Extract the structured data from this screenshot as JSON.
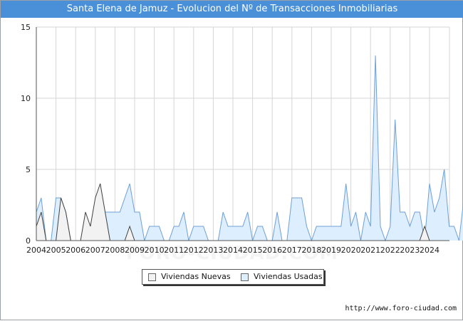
{
  "title": "Santa Elena de Jamuz - Evolucion del Nº de Transacciones Inmobiliarias",
  "source": "http://www.foro-ciudad.com",
  "watermark": "FORO-CIUDAD.COM",
  "colors": {
    "title_bar": "#4a90d9",
    "nuevas_fill": "#f2f2f2",
    "nuevas_line": "#404040",
    "usadas_fill": "#ddeeff",
    "usadas_line": "#6e9fd6",
    "grid": "#d6d6d6"
  },
  "chart_data": {
    "type": "area",
    "x_unit": "quarter",
    "x_start": "2004 Q1",
    "ylim": [
      0,
      15
    ],
    "yticks": [
      0,
      5,
      10,
      15
    ],
    "xtick_labels": [
      "2004",
      "2005",
      "2006",
      "2007",
      "2008",
      "2009",
      "2010",
      "2011",
      "2012",
      "2013",
      "2014",
      "2015",
      "2016",
      "2017",
      "2018",
      "2019",
      "2020",
      "2021",
      "2022",
      "2023",
      "2024"
    ],
    "grid": true,
    "legend_position": "bottom-center",
    "series": [
      {
        "name": "Viviendas Nuevas",
        "values": [
          1,
          2,
          0,
          0,
          0,
          3,
          2,
          0,
          0,
          0,
          2,
          1,
          3,
          4,
          2,
          0,
          0,
          0,
          0,
          1,
          0,
          0,
          0,
          0,
          0,
          0,
          0,
          0,
          0,
          0,
          0,
          0,
          0,
          0,
          0,
          0,
          0,
          0,
          0,
          0,
          0,
          0,
          0,
          0,
          0,
          0,
          0,
          0,
          0,
          0,
          0,
          0,
          0,
          0,
          0,
          0,
          0,
          0,
          0,
          0,
          0,
          0,
          0,
          0,
          0,
          0,
          0,
          0,
          0,
          0,
          0,
          0,
          0,
          0,
          0,
          0,
          0,
          0,
          0,
          1,
          0,
          0,
          0,
          0
        ]
      },
      {
        "name": "Viviendas Usadas",
        "values": [
          2,
          3,
          0,
          0,
          3,
          3,
          2,
          0,
          0,
          0,
          0,
          0,
          0,
          0,
          2,
          2,
          2,
          2,
          3,
          4,
          2,
          2,
          0,
          1,
          1,
          1,
          0,
          0,
          1,
          1,
          2,
          0,
          1,
          1,
          1,
          0,
          0,
          0,
          2,
          1,
          1,
          1,
          1,
          2,
          0,
          1,
          1,
          0,
          0,
          2,
          0,
          0,
          3,
          3,
          3,
          1,
          0,
          1,
          1,
          1,
          1,
          1,
          1,
          4,
          1,
          2,
          0,
          2,
          1,
          13,
          1,
          0,
          1,
          8.5,
          2,
          2,
          1,
          2,
          2,
          0,
          4,
          2,
          3,
          5,
          1,
          1,
          0,
          3,
          1
        ]
      }
    ],
    "legend": [
      "Viviendas Nuevas",
      "Viviendas Usadas"
    ]
  }
}
